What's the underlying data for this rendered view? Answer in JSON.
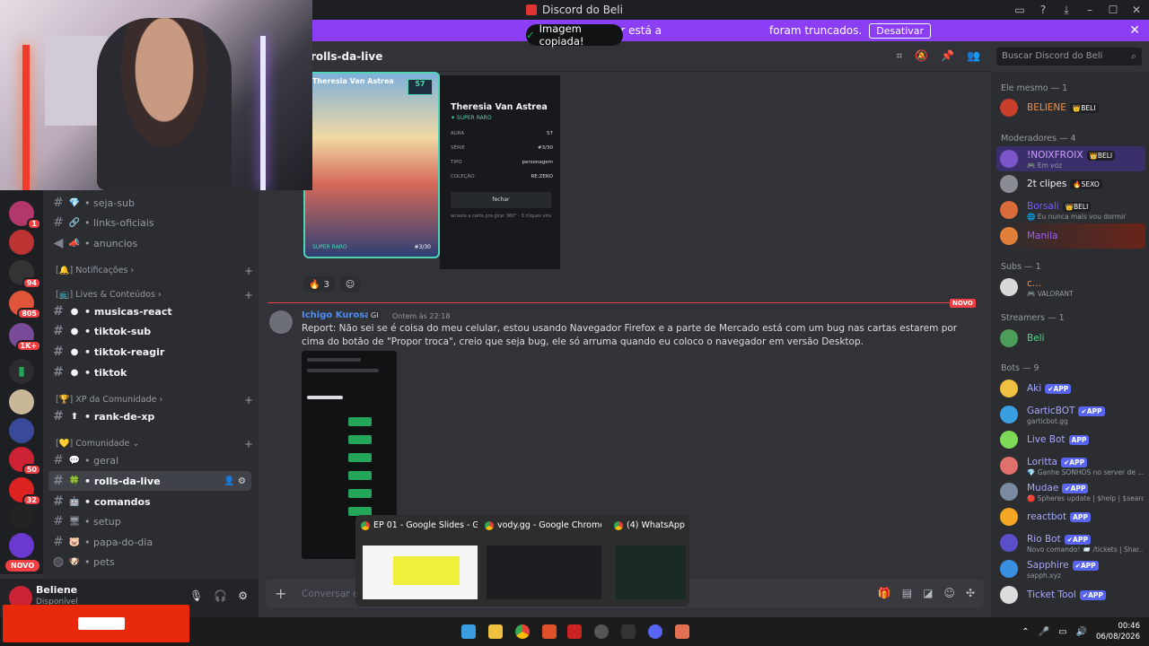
{
  "window": {
    "title": "Discord do Beli"
  },
  "banner": {
    "text": "O modo streamer está a",
    "text_right": "foram truncados.",
    "button": "Desativar"
  },
  "toast": {
    "text": "Imagem copiada!"
  },
  "channel_header": {
    "name": "rolls-da-live",
    "search_placeholder": "Buscar Discord do Beli"
  },
  "server_rail": {
    "badges": [
      "1",
      "94",
      "805",
      "1K+",
      "50",
      "32"
    ],
    "novo": "NOVO"
  },
  "channels": [
    {
      "emoji": "💎",
      "name": "• seja-sub",
      "type": "text",
      "bold": false
    },
    {
      "emoji": "🔗",
      "name": "• links-oficiais",
      "type": "text",
      "bold": false
    },
    {
      "emoji": "📣",
      "name": "• anuncios",
      "type": "announce",
      "bold": false
    }
  ],
  "categories": [
    {
      "label": "[🔔] Notificações ›"
    },
    {
      "label": "[📺] Lives & Conteúdos ›"
    },
    {
      "label": "[🏆] XP da Comunidade ›"
    },
    {
      "label": "[💛] Comunidade ⌄"
    }
  ],
  "channels_live": [
    {
      "name": "• musicas-react"
    },
    {
      "name": "• tiktok-sub"
    },
    {
      "name": "• tiktok-reagir"
    },
    {
      "name": "• tiktok"
    }
  ],
  "channels_xp": [
    {
      "name": "• rank-de-xp"
    }
  ],
  "channels_comunidade": [
    {
      "name": "• geral",
      "bold": false
    },
    {
      "name": "• rolls-da-live",
      "bold": true,
      "active": true
    },
    {
      "name": "• comandos",
      "bold": true
    },
    {
      "name": "• setup",
      "bold": false
    },
    {
      "name": "• papa-do-dia",
      "bold": false
    },
    {
      "name": "• pets",
      "bold": false
    }
  ],
  "user": {
    "name": "Beliene",
    "status": "Disponível"
  },
  "card": {
    "name": "Theresia Van Astrea",
    "rarity": "✦ SUPER RARO",
    "aura_label": "AURA",
    "aura_value": "57",
    "serie_label": "SÉRIE",
    "serie_value": "#3/30",
    "tipo_label": "TIPO",
    "tipo_value": "personagem",
    "colecao_label": "COLEÇÃO",
    "colecao_value": "RE:ZERO",
    "fechar": "fechar",
    "hint": "arraste a carta pra girar 360° · 3 cliques vira",
    "card_rarity": "SUPER RARO",
    "card_number": "#3/30"
  },
  "reactions": [
    {
      "emoji": "🔥",
      "count": "3"
    }
  ],
  "divider_label": "NOVO",
  "message": {
    "author": "Ichigo Kurosaki",
    "tag": "GI",
    "time": "Ontem às 22:18",
    "text": "Report: Não sei se é coisa do meu celular, estou usando Navegador Firefox e a parte de Mercado está com um bug nas cartas estarem por cima do botão de \"Propor troca\", creio que seja bug, ele só arruma quando eu coloco o navegador em versão Desktop."
  },
  "previews": [
    {
      "title": "EP 01 - Google Slides - G..."
    },
    {
      "title": "vody.gg - Google Chrome"
    },
    {
      "title": "(4) WhatsApp..."
    }
  ],
  "composer": {
    "placeholder": "Conversar em"
  },
  "members": {
    "groups": [
      {
        "header": "Ele mesmo — 1",
        "items": [
          {
            "name": "BELIENE",
            "color": "#f0904a",
            "tag": "👑BELI",
            "avatar": "#c8402a"
          }
        ]
      },
      {
        "header": "Moderadores — 4",
        "items": [
          {
            "name": "!NOIXFROIX",
            "color": "#c9a0ff",
            "tag": "👑BELI",
            "sub": "🎮 Em voz",
            "avatar": "#7b55c9"
          },
          {
            "name": "2t clipes",
            "color": "#f2f3f5",
            "tag": "🔥SEXO",
            "avatar": "#8a8c93"
          },
          {
            "name": "Borsali",
            "color": "#7a5cff",
            "tag": "👑BELI",
            "sub": "🌐 Eu nunca mais vou dormir",
            "avatar": "#d96a3a"
          },
          {
            "name": "Manila",
            "color": "#a05cff",
            "tag": "",
            "avatar": "#e0803a"
          }
        ]
      },
      {
        "header": "Subs — 1",
        "items": [
          {
            "name": "c...",
            "color": "#f0904a",
            "tag": "",
            "sub": "🎮 VALORANT",
            "avatar": "#d8d8d8"
          }
        ]
      },
      {
        "header": "Streamers — 1",
        "items": [
          {
            "name": "Beli",
            "color": "#57d78d",
            "tag": "",
            "avatar": "#4c9c5a"
          }
        ]
      },
      {
        "header": "Bots — 9",
        "items": [
          {
            "name": "Aki",
            "color": "#a5a8ff",
            "tag": "✔APP",
            "avatar": "#f0c040"
          },
          {
            "name": "GarticBOT",
            "color": "#a5a8ff",
            "tag": "✔APP",
            "sub": "garticbot.gg",
            "avatar": "#3a9de0"
          },
          {
            "name": "Live Bot",
            "color": "#a5a8ff",
            "tag": "APP",
            "avatar": "#7ed957"
          },
          {
            "name": "Loritta",
            "color": "#a5a8ff",
            "tag": "✔APP",
            "sub": "💎 Ganhe SONHOS no server de ...",
            "avatar": "#e0706a"
          },
          {
            "name": "Mudae",
            "color": "#a5a8ff",
            "tag": "✔APP",
            "sub": "🔴 Spheres update | $help | $search",
            "avatar": "#7a8aa0"
          },
          {
            "name": "reactbot",
            "color": "#a5a8ff",
            "tag": "APP",
            "avatar": "#f5a623"
          },
          {
            "name": "Rio Bot",
            "color": "#a5a8ff",
            "tag": "✔APP",
            "sub": "Novo comando! 📨 /tickets | Shar...",
            "avatar": "#5a4fc9"
          },
          {
            "name": "Sapphire",
            "color": "#a5a8ff",
            "tag": "✔APP",
            "sub": "sapph.xyz",
            "avatar": "#3a8ee0"
          },
          {
            "name": "Ticket Tool",
            "color": "#a5a8ff",
            "tag": "✔APP",
            "avatar": "#dcdcdc"
          }
        ]
      }
    ]
  },
  "taskbar": {
    "time": "00:46",
    "date": "06/08/2026"
  }
}
